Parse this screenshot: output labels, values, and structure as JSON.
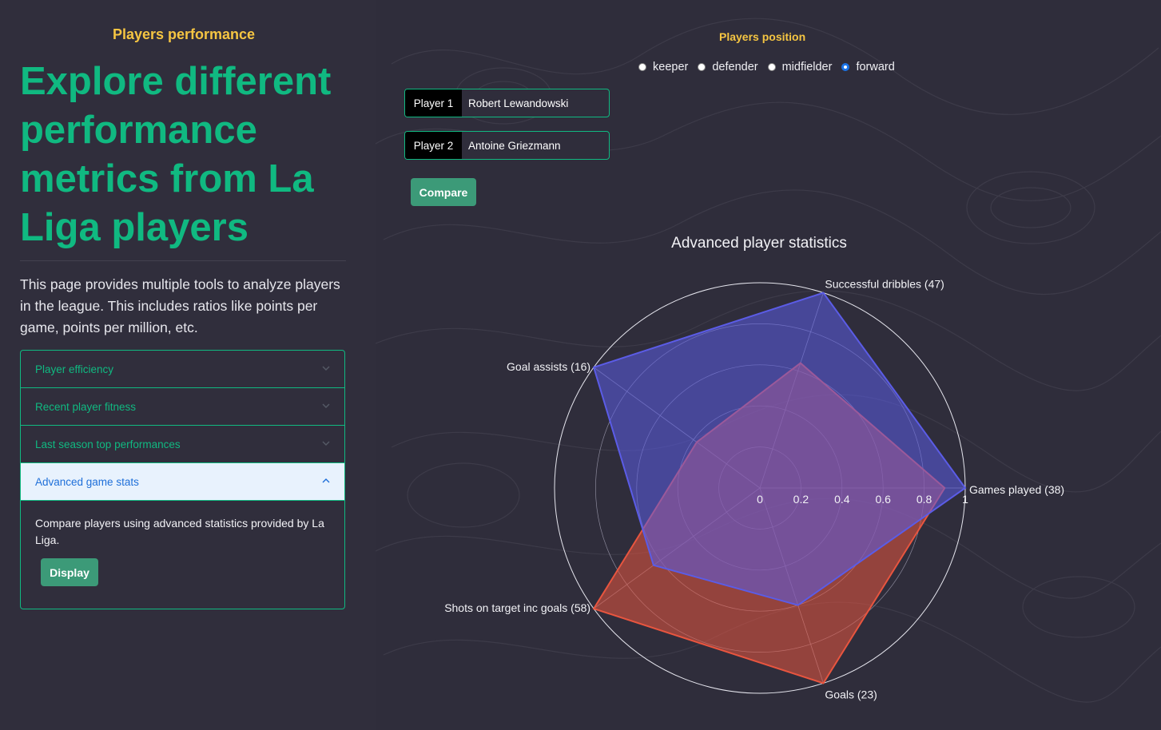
{
  "sidebar": {
    "eyebrow": "Players performance",
    "headline": "Explore different performance metrics from La Liga players",
    "description": "This page provides multiple tools to analyze players in the league. This includes ratios like points per game, points per million, etc.",
    "accordion": [
      {
        "label": "Player efficiency",
        "open": false
      },
      {
        "label": "Recent player fitness",
        "open": false
      },
      {
        "label": "Last season top performances",
        "open": false
      },
      {
        "label": "Advanced game stats",
        "open": true
      }
    ],
    "open_body": "Compare players using advanced statistics provided by La Liga.",
    "display_label": "Display"
  },
  "controls": {
    "position_title": "Players position",
    "positions": [
      "keeper",
      "defender",
      "midfielder",
      "forward"
    ],
    "selected_position": "forward",
    "player1_tag": "Player 1",
    "player1_value": "Robert Lewandowski",
    "player2_tag": "Player 2",
    "player2_value": "Antoine Griezmann",
    "compare_label": "Compare"
  },
  "colors": {
    "accent_green": "#10b981",
    "accent_yellow": "#f5c542",
    "series_blue": "#5b5ce6",
    "series_red": "#e8553f"
  },
  "chart_data": {
    "type": "radar",
    "title": "Advanced player statistics",
    "axes": [
      "Games played (38)",
      "Successful dribbles (47)",
      "Goal assists (16)",
      "Shots on target inc goals (58)",
      "Goals (23)"
    ],
    "radial_ticks": [
      "0",
      "0.2",
      "0.4",
      "0.6",
      "0.8",
      "1"
    ],
    "rlim": [
      0,
      1
    ],
    "series": [
      {
        "values": [
          1.0,
          1.0,
          1.0,
          0.64,
          0.6
        ],
        "color": "#5b5ce6"
      },
      {
        "values": [
          0.9,
          0.64,
          0.38,
          1.0,
          1.0
        ],
        "color": "#e8553f"
      }
    ]
  }
}
